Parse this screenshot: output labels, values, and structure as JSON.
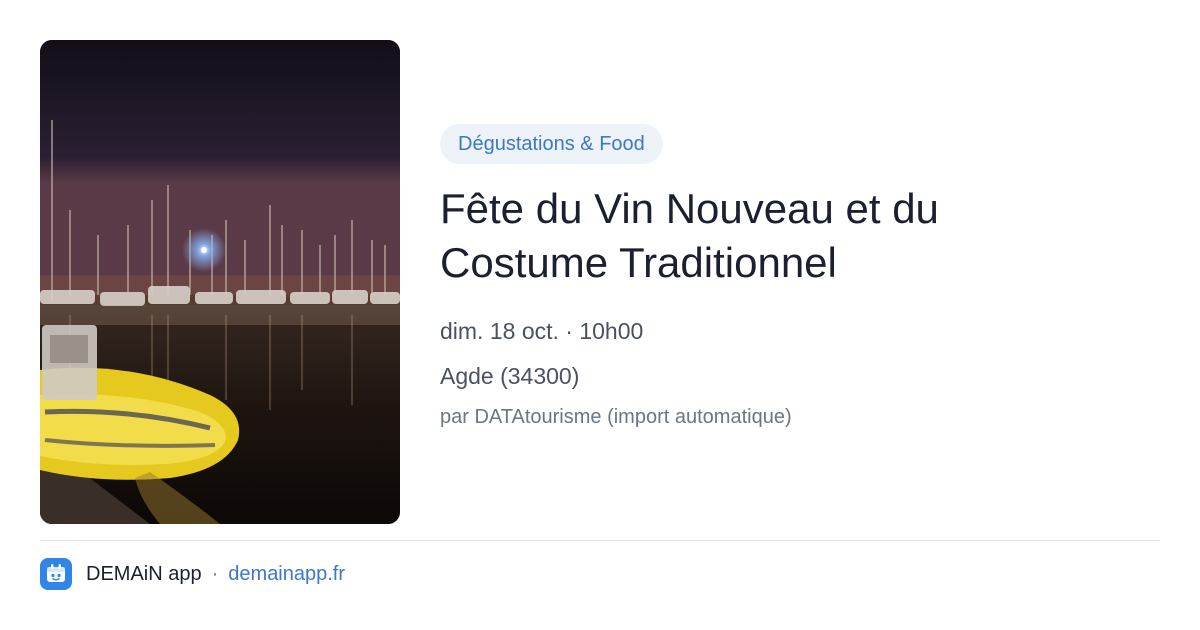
{
  "event": {
    "image_alt": "Port de plaisance de nuit avec bateaux et reflets",
    "category": "Dégustations & Food",
    "title": "Fête du Vin Nouveau et du Costume Traditionnel",
    "datetime": "dim. 18 oct. · 10h00",
    "location": "Agde (34300)",
    "source": "par DATAtourisme (import automatique)"
  },
  "footer": {
    "app_name": "DEMAiN app",
    "separator": "·",
    "link_text": "demainapp.fr",
    "logo_icon": "demain-app-logo-icon"
  },
  "colors": {
    "accent": "#3b78c9",
    "badge_bg": "#eef3fa",
    "title": "#1b2030",
    "meta": "#4a5262",
    "muted": "#6b7585",
    "logo_bg": "#2f86e8"
  }
}
